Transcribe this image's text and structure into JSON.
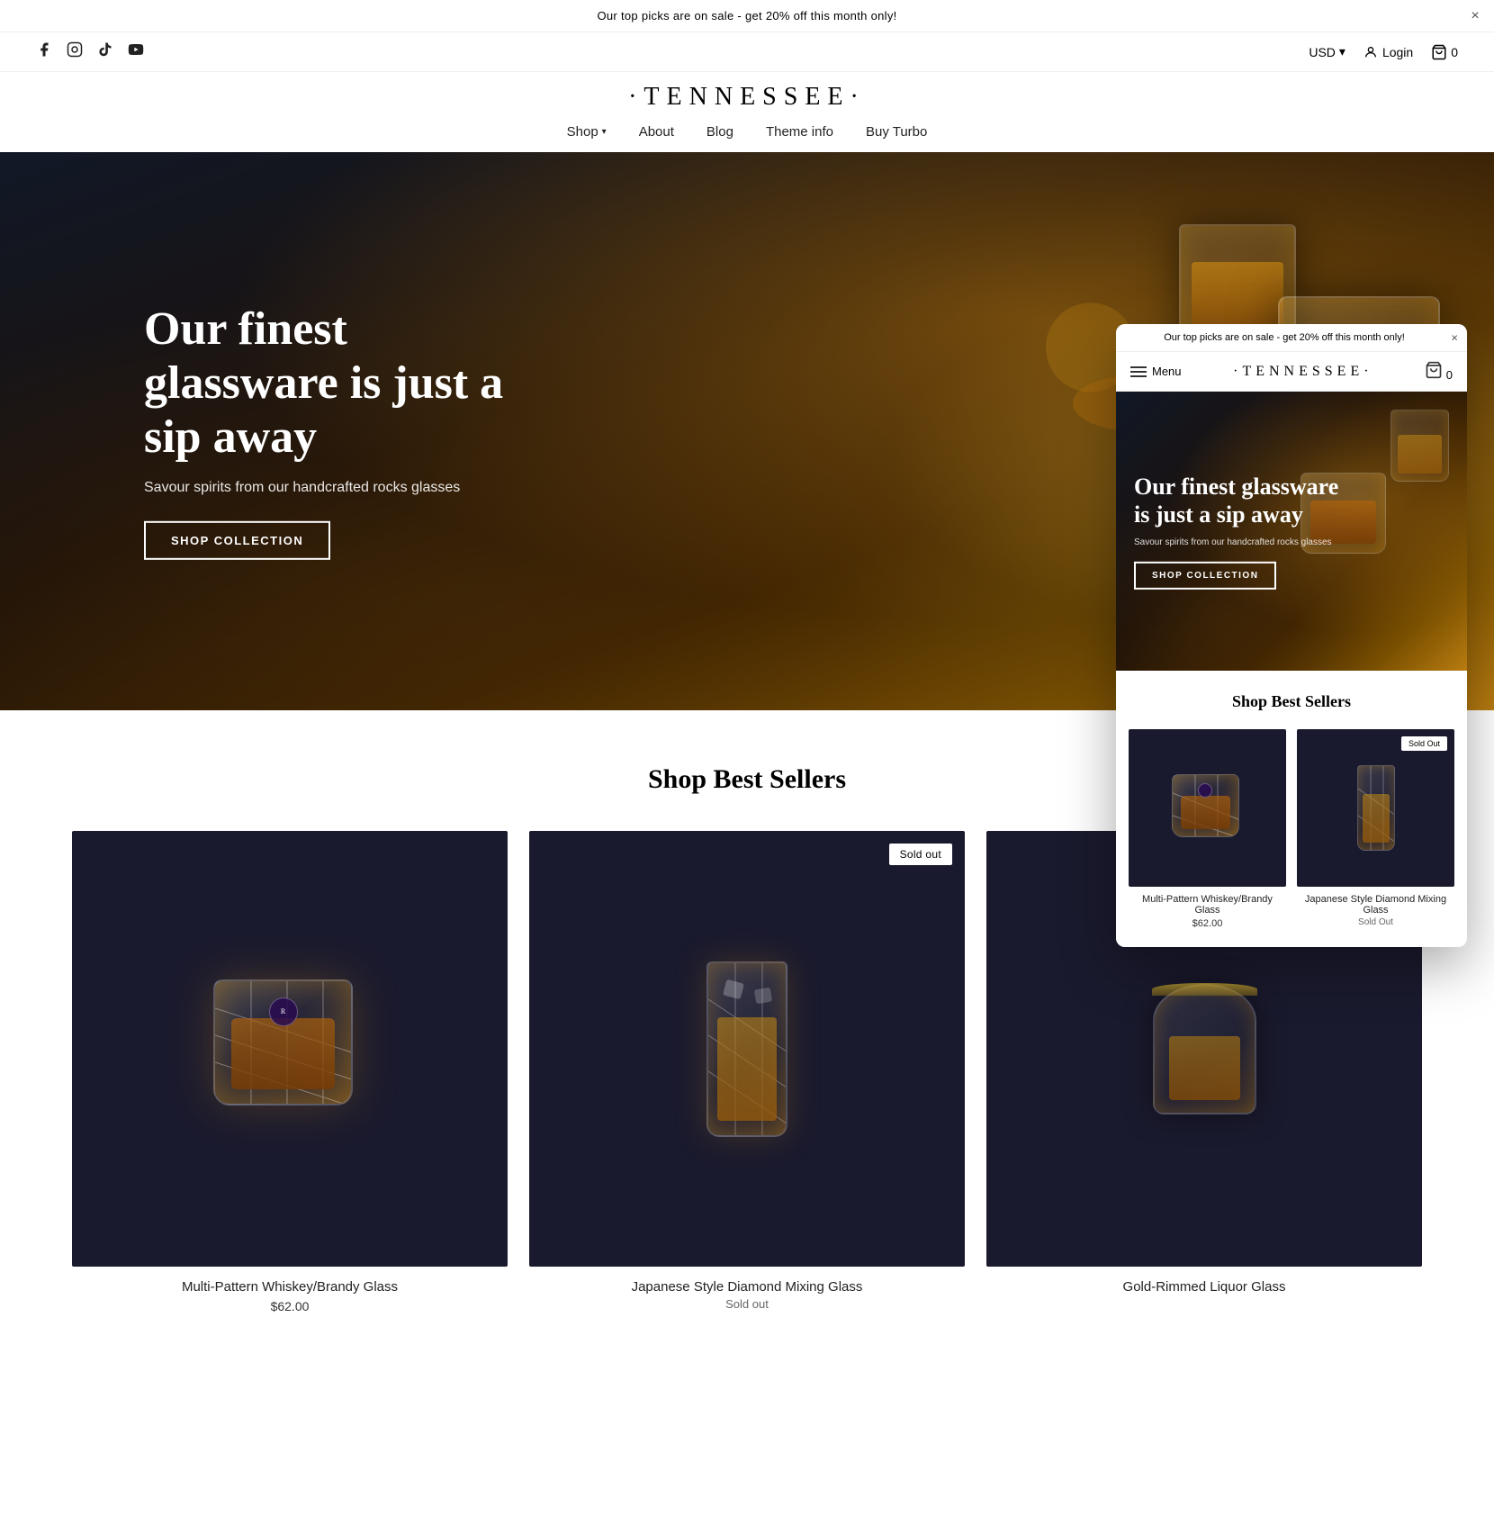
{
  "announcement": {
    "text": "Our top picks are on sale - get 20% off this month only!",
    "close_label": "×"
  },
  "social": {
    "icons": [
      "facebook",
      "instagram",
      "tiktok",
      "youtube"
    ]
  },
  "top_right": {
    "currency": "USD",
    "login_label": "Login",
    "cart_label": "0"
  },
  "logo": {
    "text": "·TENNESSEE·"
  },
  "nav": {
    "items": [
      {
        "label": "Shop",
        "has_dropdown": true
      },
      {
        "label": "About",
        "has_dropdown": false
      },
      {
        "label": "Blog",
        "has_dropdown": false
      },
      {
        "label": "Theme info",
        "has_dropdown": false
      },
      {
        "label": "Buy Turbo",
        "has_dropdown": false
      }
    ]
  },
  "hero": {
    "title": "Our finest glassware is just a sip away",
    "subtitle": "Savour spirits from our handcrafted rocks glasses",
    "cta_label": "SHOP COLLECTION"
  },
  "products_section": {
    "title": "Shop Best Sellers",
    "products": [
      {
        "name": "Multi-Pattern Whiskey/Brandy Glass",
        "price": "$62.00",
        "sold_out": false,
        "status": ""
      },
      {
        "name": "Japanese Style Diamond Mixing Glass",
        "price": "",
        "sold_out": true,
        "status": "Sold out"
      },
      {
        "name": "Gold-Rimmed Liquor Glass",
        "price": "",
        "sold_out": false,
        "status": ""
      }
    ]
  },
  "mobile": {
    "announcement": "Our top picks are on sale - get 20% off this month only!",
    "close_label": "×",
    "menu_label": "Menu",
    "logo": "·TENNESSEE·",
    "cart_label": "0",
    "hero": {
      "title": "Our finest glassware is just a sip away",
      "subtitle": "Savour spirits from our handcrafted rocks glasses",
      "cta_label": "SHOP COLLECTION"
    },
    "products_section": {
      "title": "Shop Best Sellers",
      "products": [
        {
          "name": "Multi-Pattern Whiskey/Brandy Glass",
          "price": "$62.00",
          "sold_out": false,
          "status": ""
        },
        {
          "name": "Japanese Style Diamond Mixing Glass",
          "sold_out": true,
          "status": "Sold Out"
        }
      ]
    }
  }
}
